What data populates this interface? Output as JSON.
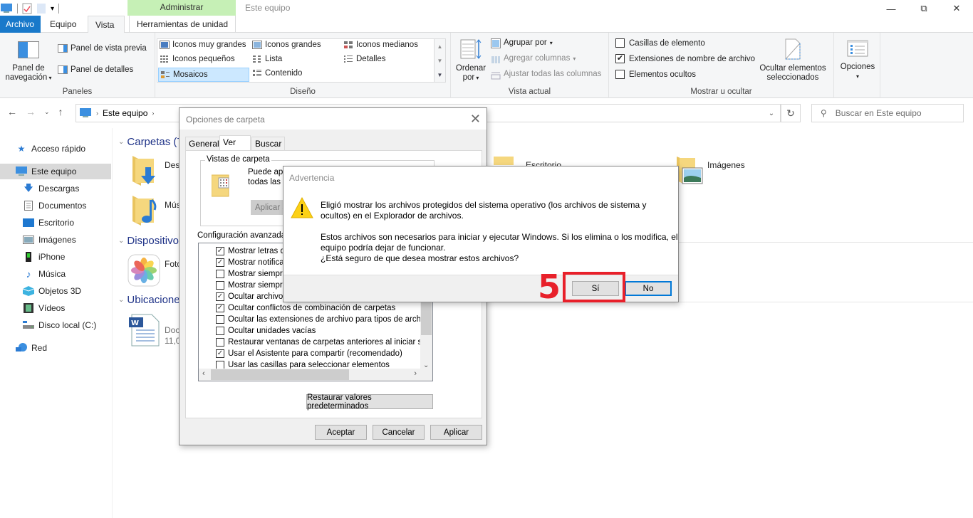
{
  "window": {
    "title": "Este equipo",
    "contextual_tab_group": "Administrar",
    "controls": [
      "minimize",
      "restore",
      "close"
    ]
  },
  "ribbon": {
    "tabs": [
      {
        "label": "Archivo",
        "active": false
      },
      {
        "label": "Equipo",
        "active": false
      },
      {
        "label": "Vista",
        "active": true
      },
      {
        "label": "Herramientas de unidad",
        "active": false
      }
    ],
    "groups": {
      "paneles": {
        "label": "Paneles",
        "nav_pane_line1": "Panel de",
        "nav_pane_line2": "navegación",
        "preview_pane": "Panel de vista previa",
        "details_pane": "Panel de detalles"
      },
      "diseno": {
        "label": "Diseño",
        "items": [
          {
            "label": "Iconos muy grandes",
            "selected": false
          },
          {
            "label": "Iconos grandes",
            "selected": false
          },
          {
            "label": "Iconos medianos",
            "selected": false
          },
          {
            "label": "Iconos pequeños",
            "selected": false
          },
          {
            "label": "Lista",
            "selected": false
          },
          {
            "label": "Detalles",
            "selected": false
          },
          {
            "label": "Mosaicos",
            "selected": true
          },
          {
            "label": "Contenido",
            "selected": false
          }
        ]
      },
      "vista_actual": {
        "label": "Vista actual",
        "sort_line1": "Ordenar",
        "sort_line2": "por",
        "group_by": "Agrupar por",
        "add_columns": "Agregar columnas",
        "fit_columns": "Ajustar todas las columnas"
      },
      "mostrar_ocultar": {
        "label": "Mostrar u ocultar",
        "checkboxes": [
          {
            "label": "Casillas de elemento",
            "checked": false
          },
          {
            "label": "Extensiones de nombre de archivo",
            "checked": true
          },
          {
            "label": "Elementos ocultos",
            "checked": false
          }
        ],
        "hide_selected_line1": "Ocultar elementos",
        "hide_selected_line2": "seleccionados"
      },
      "opciones": {
        "label": "Opciones"
      }
    }
  },
  "address_bar": {
    "breadcrumb": [
      "Este equipo"
    ],
    "search_placeholder": "Buscar en Este equipo"
  },
  "nav_pane": {
    "items": [
      {
        "label": "Acceso rápido",
        "icon": "star-icon",
        "level": 0,
        "selected": false
      },
      {
        "label": "Este equipo",
        "icon": "computer-icon",
        "level": 0,
        "selected": true
      },
      {
        "label": "Descargas",
        "icon": "download-icon",
        "level": 1,
        "selected": false
      },
      {
        "label": "Documentos",
        "icon": "document-icon",
        "level": 1,
        "selected": false
      },
      {
        "label": "Escritorio",
        "icon": "desktop-icon",
        "level": 1,
        "selected": false
      },
      {
        "label": "Imágenes",
        "icon": "pictures-icon",
        "level": 1,
        "selected": false
      },
      {
        "label": "iPhone",
        "icon": "phone-icon",
        "level": 1,
        "selected": false
      },
      {
        "label": "Música",
        "icon": "music-icon",
        "level": 1,
        "selected": false
      },
      {
        "label": "Objetos 3D",
        "icon": "cube-icon",
        "level": 1,
        "selected": false
      },
      {
        "label": "Vídeos",
        "icon": "video-icon",
        "level": 1,
        "selected": false
      },
      {
        "label": "Disco local (C:)",
        "icon": "drive-icon",
        "level": 1,
        "selected": false
      },
      {
        "label": "Red",
        "icon": "network-icon",
        "level": 0,
        "selected": false
      }
    ]
  },
  "content": {
    "sections": [
      {
        "label": "Carpetas (7"
      },
      {
        "label": "Dispositivo"
      },
      {
        "label": "Ubicacione"
      }
    ],
    "tiles": {
      "descargas": "Des",
      "musica": "Mús",
      "escritorio": "Escritorio",
      "imagenes": "Imágenes",
      "fotos": "Foto",
      "doc_name": "Doc",
      "doc_size": "11,0"
    }
  },
  "folder_options": {
    "title": "Opciones de carpeta",
    "tabs": [
      {
        "label": "General",
        "active": false
      },
      {
        "label": "Ver",
        "active": true
      },
      {
        "label": "Buscar",
        "active": false
      }
    ],
    "folder_views": {
      "legend": "Vistas de carpeta",
      "text_line1": "Puede apli",
      "text_line2": "todas las c",
      "apply_button": "Aplicar a"
    },
    "advanced_label": "Configuración avanzada:",
    "advanced_items": [
      {
        "label": "Mostrar letras de",
        "checked": true
      },
      {
        "label": "Mostrar notificac",
        "checked": true
      },
      {
        "label": "Mostrar siempre i",
        "checked": false
      },
      {
        "label": "Mostrar siempre r",
        "checked": false
      },
      {
        "label": "Ocultar archivos",
        "checked": true
      },
      {
        "label": "Ocultar conflictos de combinación de carpetas",
        "checked": true
      },
      {
        "label": "Ocultar las extensiones de archivo para tipos de archivo c",
        "checked": false
      },
      {
        "label": "Ocultar unidades vacías",
        "checked": false
      },
      {
        "label": "Restaurar ventanas de carpetas anteriores al iniciar sesió",
        "checked": false
      },
      {
        "label": "Usar el Asistente para compartir (recomendado)",
        "checked": true
      },
      {
        "label": "Usar las casillas para seleccionar elementos",
        "checked": false
      }
    ],
    "restore_defaults": "Restaurar valores predeterminados",
    "buttons": {
      "ok": "Aceptar",
      "cancel": "Cancelar",
      "apply": "Aplicar"
    }
  },
  "warning": {
    "title": "Advertencia",
    "line1": "Eligió mostrar los archivos protegidos del sistema operativo (los archivos de sistema y",
    "line2": "ocultos) en el Explorador de archivos.",
    "line3": "Estos archivos son necesarios para iniciar y ejecutar Windows. Si los elimina o los modifica, el",
    "line4": "equipo podría dejar de funcionar.",
    "line5": "¿Está seguro de que desea mostrar estos archivos?",
    "yes": "Sí",
    "no": "No"
  },
  "annotation": {
    "step_number": "5",
    "color": "#e8202a"
  }
}
